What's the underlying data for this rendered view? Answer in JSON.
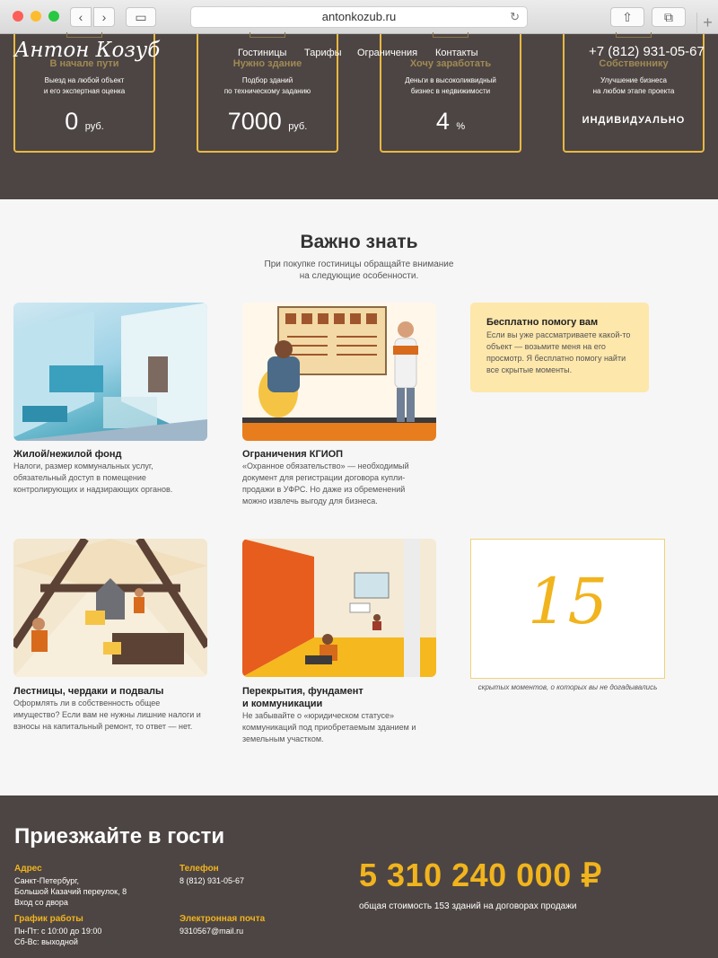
{
  "browser": {
    "url": "antonkozub.ru",
    "colors": {
      "close": "#fc5f57",
      "min": "#fdbc2e",
      "max": "#28c840"
    }
  },
  "header": {
    "logo": "Антон Козуб",
    "menu": [
      "Гостиницы",
      "Тарифы",
      "Ограничения",
      "Контакты"
    ],
    "phone": "+7 (812) 931-05-67"
  },
  "tariffs": [
    {
      "title": "В начале пути",
      "desc": "Выезд на любой объект\nи его экспертная оценка",
      "price": "0",
      "unit": "руб."
    },
    {
      "title": "Нужно здание",
      "desc": "Подбор зданий\nпо техническому заданию",
      "price": "7000",
      "unit": "руб."
    },
    {
      "title": "Хочу заработать",
      "desc": "Деньги в высоколиквидный\nбизнес в недвижимости",
      "price": "4",
      "unit": "%"
    },
    {
      "title": "Собственнику",
      "desc": "Улучшение бизнеса\nна любом этапе проекта",
      "price": "ИНДИВИДУАЛЬНО",
      "unit": ""
    }
  ],
  "important": {
    "title": "Важно знать",
    "subtitle": "При покупке гостиницы обращайте внимание на следующие особенности.",
    "items": [
      {
        "title": "Жилой/нежилой фонд",
        "text": "Налоги, размер коммунальных услуг, обязательный доступ в помещение контролирующих и надзирающих органов."
      },
      {
        "title": "Ограничения КГИОП",
        "text": "«Охранное обязательство» — необходимый документ для регистрации договора купли-продажи в УФРС. Но даже из обременений можно извлечь выгоду для бизнеса."
      },
      {
        "title": "Лестницы, чердаки и подвалы",
        "text": "Оформлять ли в собственность общее имуществo? Если вам не нужны лишние налоги и взносы на капитальный ремонт, то ответ — нет."
      },
      {
        "title": "Перекрытия, фундамент\nи коммуникации",
        "text": "Не забывайте о «юридическом статусе» коммуникаций под приобретаемым зданием и земельным участком."
      }
    ],
    "help": {
      "title": "Бесплатно помогу вам",
      "text": "Если вы уже рассматриваете какой-то объект — возьмите меня на его просмотр. Я бесплатно помогу найти все скрытые моменты."
    },
    "counter": {
      "number": "15",
      "caption": "скрытых моментов, о которых вы не догадывались"
    }
  },
  "footer": {
    "title": "Приезжайте в гости",
    "address_label": "Адрес",
    "address": "Санкт-Петербург,\nБольшой Казачий переулок, 8\nВход со двора",
    "schedule_label": "График работы",
    "schedule": "Пн-Пт: с 10:00 до 19:00\nСб-Вс: выходной",
    "phone_label": "Телефон",
    "phone": "8 (812) 931-05-67",
    "email_label": "Электронная почта",
    "email": "9310567@mail.ru",
    "total": "5 310 240 000 ₽",
    "total_caption": "общая стоимость 153 зданий на договорах продажи"
  }
}
